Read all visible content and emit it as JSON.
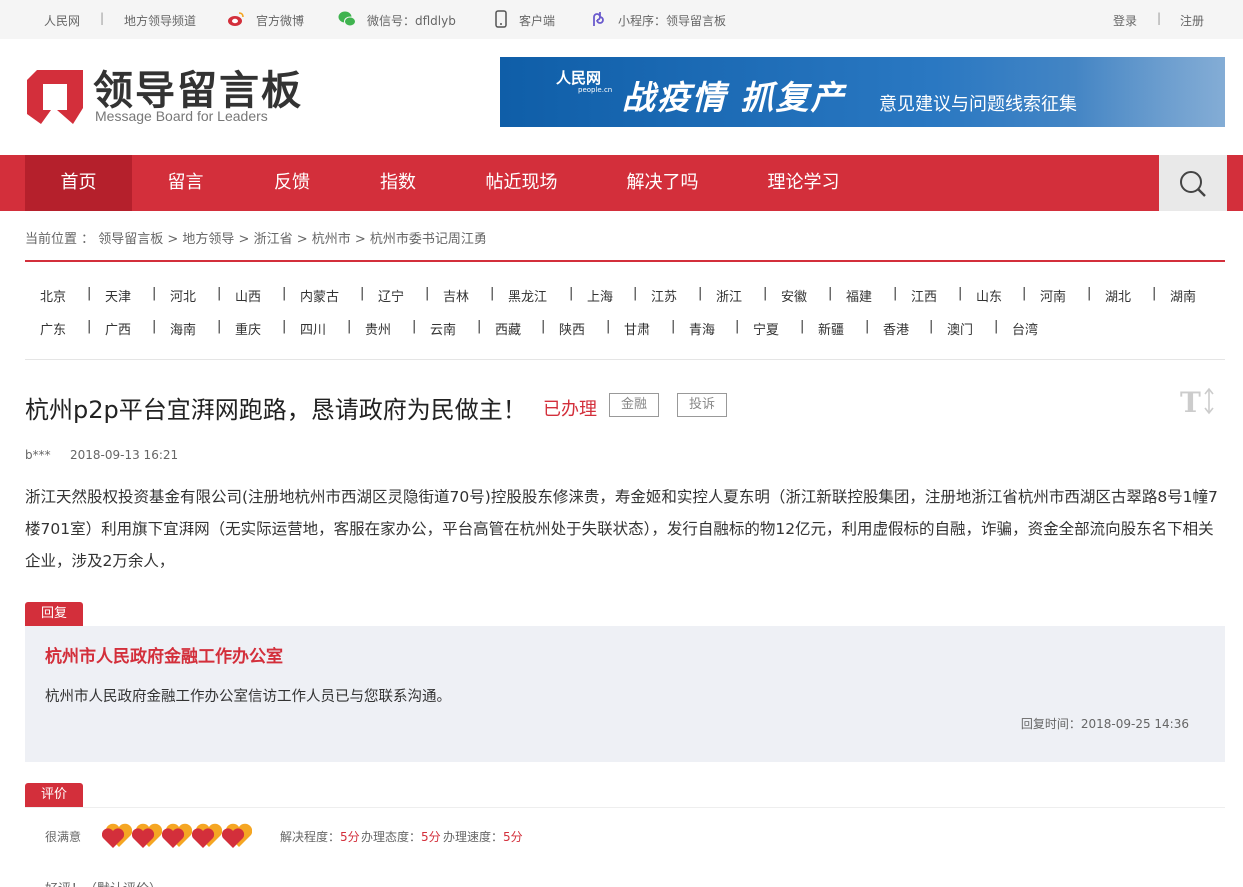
{
  "topbar": {
    "people": "人民网",
    "sep": "|",
    "local_channel": "地方领导频道",
    "weibo": "官方微博",
    "wechat": "微信号：dfldlyb",
    "client": "客户端",
    "miniapp": "小程序：领导留言板",
    "login": "登录",
    "register": "注册"
  },
  "header": {
    "logo_cn": "领导留言板",
    "logo_en": "Message Board for Leaders",
    "banner_logo": "人民网",
    "banner_logo_sub": "people.cn",
    "banner_title": "战疫情  抓复产",
    "banner_sub": "意见建议与问题线索征集"
  },
  "nav": {
    "items": [
      "首页",
      "留言",
      "反馈",
      "指数",
      "帖近现场",
      "解决了吗",
      "理论学习"
    ]
  },
  "breadcrumb": {
    "text": "当前位置 ： 领导留言板 > 地方领导 > 浙江省 > 杭州市 > 杭州市委书记周江勇"
  },
  "regions": {
    "row1": [
      "北京",
      "天津",
      "河北",
      "山西",
      "内蒙古",
      "辽宁",
      "吉林",
      "黑龙江",
      "上海",
      "江苏",
      "浙江",
      "安徽",
      "福建",
      "江西",
      "山东",
      "河南",
      "湖北",
      "湖南"
    ],
    "row2": [
      "广东",
      "广西",
      "海南",
      "重庆",
      "四川",
      "贵州",
      "云南",
      "西藏",
      "陕西",
      "甘肃",
      "青海",
      "宁夏",
      "新疆",
      "香港",
      "澳门",
      "台湾"
    ]
  },
  "article": {
    "title": "杭州p2p平台宜湃网跑路，恳请政府为民做主！",
    "status": "已办理",
    "tags": [
      "金融",
      "投诉"
    ],
    "user": "b***",
    "time": "2018-09-13 16:21",
    "content": "浙江天然股权投资基金有限公司(注册地杭州市西湖区灵隐街道70号)控股股东修涞贵，寿金姬和实控人夏东明（浙江新联控股集团，注册地浙江省杭州市西湖区古翠路8号1幢7楼701室）利用旗下宜湃网（无实际运营地，客服在家办公，平台高管在杭州处于失联状态），发行自融标的物12亿元，利用虚假标的自融，诈骗，资金全部流向股东名下相关企业，涉及2万余人，"
  },
  "reply": {
    "tab": "回复",
    "org": "杭州市人民政府金融工作办公室",
    "text": "杭州市人民政府金融工作办公室信访工作人员已与您联系沟通。",
    "time": "回复时间：2018-09-25 14:36"
  },
  "evaluation": {
    "tab": "评价",
    "label": "很满意",
    "hearts": 5,
    "heart_colors": {
      "back": "#f5a623",
      "front": "#d32f3b"
    },
    "solve_label": "解决程度：",
    "solve_value": "5分",
    "attitude_label": "办理态度：",
    "attitude_value": "5分",
    "speed_label": "办理速度：",
    "speed_value": "5分",
    "more": "好评！（默认评价）"
  },
  "colors": {
    "brand": "#d32f3b",
    "nav_active": "#b5202c"
  }
}
